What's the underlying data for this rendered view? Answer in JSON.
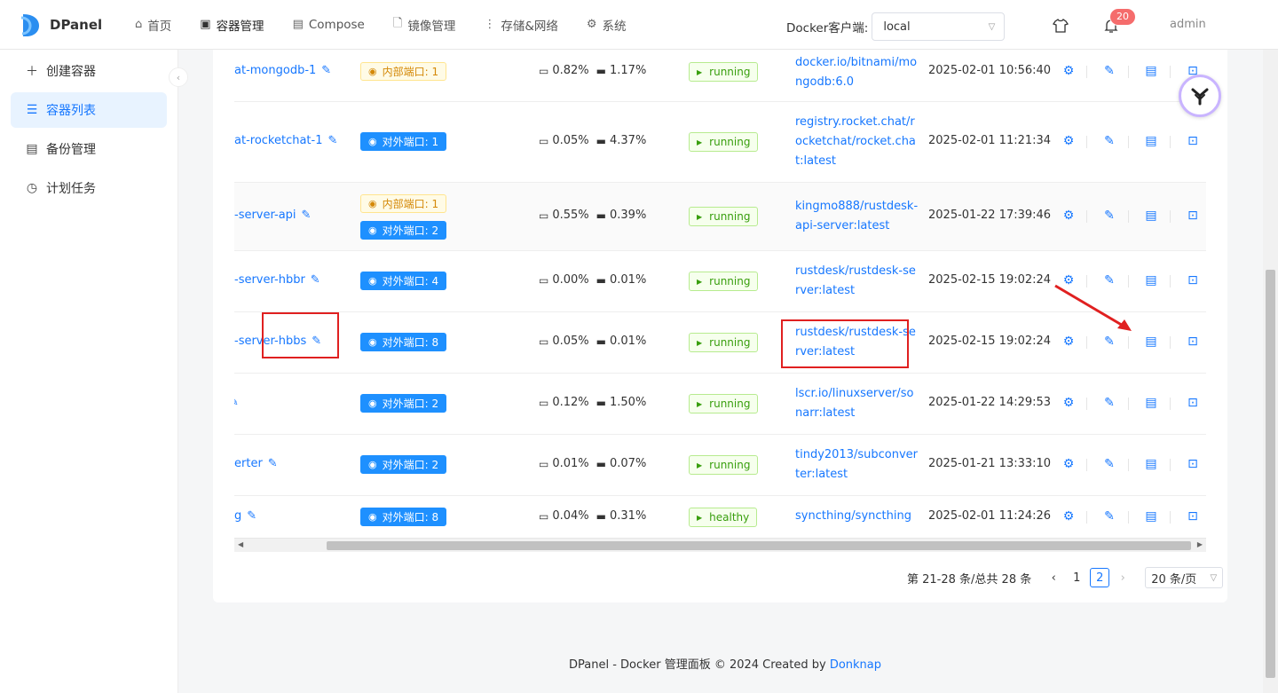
{
  "header": {
    "app_name": "DPanel",
    "nav": [
      {
        "label": "首页",
        "icon": "home-icon"
      },
      {
        "label": "容器管理",
        "icon": "container-icon"
      },
      {
        "label": "Compose",
        "icon": "compose-icon"
      },
      {
        "label": "镜像管理",
        "icon": "file-icon"
      },
      {
        "label": "存储&网络",
        "icon": "more-icon"
      },
      {
        "label": "系统",
        "icon": "gear-icon"
      }
    ],
    "docker_client_label": "Docker客户端:",
    "docker_client_value": "local",
    "notification_count": "20",
    "user": "admin"
  },
  "sidebar": {
    "items": [
      {
        "label": "创建容器",
        "icon": "plus-icon"
      },
      {
        "label": "容器列表",
        "icon": "list-icon",
        "active": true
      },
      {
        "label": "备份管理",
        "icon": "backup-icon"
      },
      {
        "label": "计划任务",
        "icon": "clock-icon"
      }
    ]
  },
  "table": {
    "rows": [
      {
        "name": "at-mongodb-1",
        "ports": [
          {
            "type": "inner",
            "label": "内部端口: 1"
          }
        ],
        "cpu": "0.82%",
        "mem": "1.17%",
        "status": "running",
        "image": "docker.io/bitnami/mongodb:6.0",
        "created": "2025-02-01 10:56:40"
      },
      {
        "name": "at-rocketchat-1",
        "ports": [
          {
            "type": "outer",
            "label": "对外端口: 1"
          }
        ],
        "cpu": "0.05%",
        "mem": "4.37%",
        "status": "running",
        "image": "registry.rocket.chat/rocketchat/rocket.chat:latest",
        "created": "2025-02-01 11:21:34"
      },
      {
        "name": "-server-api",
        "ports": [
          {
            "type": "inner",
            "label": "内部端口: 1"
          },
          {
            "type": "outer",
            "label": "对外端口: 2"
          }
        ],
        "cpu": "0.55%",
        "mem": "0.39%",
        "status": "running",
        "image": "kingmo888/rustdesk-api-server:latest",
        "created": "2025-01-22 17:39:46"
      },
      {
        "name": "-server-hbbr",
        "ports": [
          {
            "type": "outer",
            "label": "对外端口: 4"
          }
        ],
        "cpu": "0.00%",
        "mem": "0.01%",
        "status": "running",
        "image": "rustdesk/rustdesk-server:latest",
        "created": "2025-02-15 19:02:24"
      },
      {
        "name": "-server-hbbs",
        "ports": [
          {
            "type": "outer",
            "label": "对外端口: 8"
          }
        ],
        "cpu": "0.05%",
        "mem": "0.01%",
        "status": "running",
        "image": "rustdesk/rustdesk-server:latest",
        "created": "2025-02-15 19:02:24"
      },
      {
        "name": "",
        "ports": [
          {
            "type": "outer",
            "label": "对外端口: 2"
          }
        ],
        "cpu": "0.12%",
        "mem": "1.50%",
        "status": "running",
        "image": "lscr.io/linuxserver/sonarr:latest",
        "created": "2025-01-22 14:29:53"
      },
      {
        "name": "erter",
        "ports": [
          {
            "type": "outer",
            "label": "对外端口: 2"
          }
        ],
        "cpu": "0.01%",
        "mem": "0.07%",
        "status": "running",
        "image": "tindy2013/subconverter:latest",
        "created": "2025-01-21 13:33:10"
      },
      {
        "name": "g",
        "ports": [
          {
            "type": "outer",
            "label": "对外端口: 8"
          }
        ],
        "cpu": "0.04%",
        "mem": "0.31%",
        "status": "healthy",
        "image": "syncthing/syncthing",
        "created": "2025-02-01 11:24:26"
      }
    ]
  },
  "pagination": {
    "info": "第 21-28 条/总共 28 条",
    "pages": [
      "1",
      "2"
    ],
    "current": "2",
    "page_size": "20 条/页"
  },
  "footer": {
    "text": "DPanel - Docker 管理面板 © 2024 Created by ",
    "link": "Donknap"
  }
}
